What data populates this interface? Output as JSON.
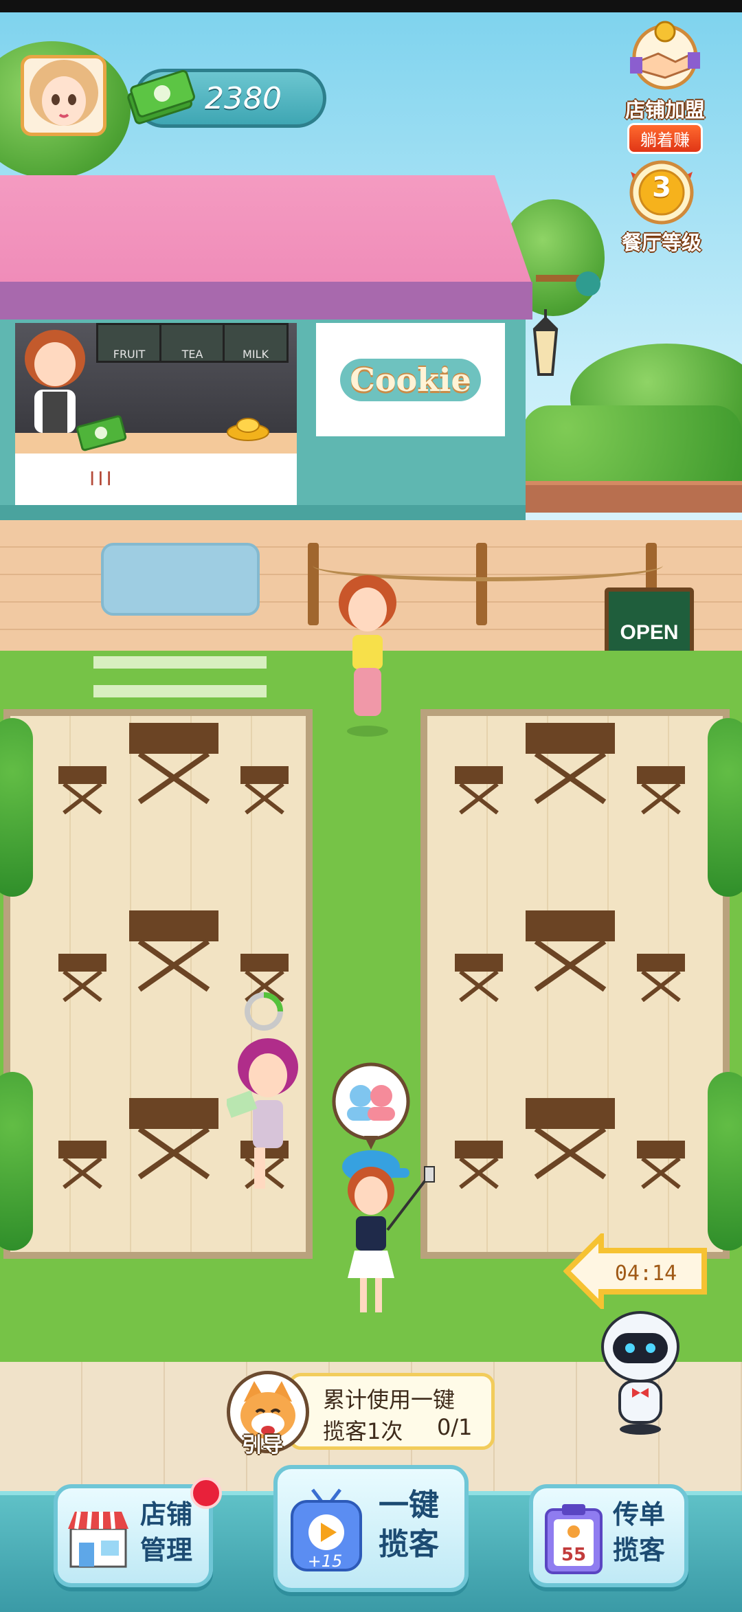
{
  "hud": {
    "money": "2380",
    "franchise_label": "店铺加盟",
    "franchise_sub": "躺着赚",
    "level_number": "3",
    "level_label": "餐厅等级"
  },
  "shop": {
    "menu_boards": [
      "FRUIT",
      "TEA",
      "MILK"
    ],
    "brand": "Cookie",
    "counter_mark": "III"
  },
  "open_sign": "OPEN",
  "timer": "04:14",
  "guide": {
    "label": "引导",
    "line1": "累计使用一键",
    "line2": "揽客1次",
    "progress": "0/1"
  },
  "bottom_buttons": {
    "store": [
      "店铺",
      "管理"
    ],
    "one_click": [
      "一键",
      "揽客"
    ],
    "one_click_bonus": "+15",
    "flyer": [
      "传单",
      "揽客"
    ],
    "flyer_count": "55"
  },
  "colors": {
    "roof": "#f49bc1",
    "shop": "#5fb7b1",
    "lawn": "#76c347",
    "accent_gold": "#f2cc5b"
  }
}
